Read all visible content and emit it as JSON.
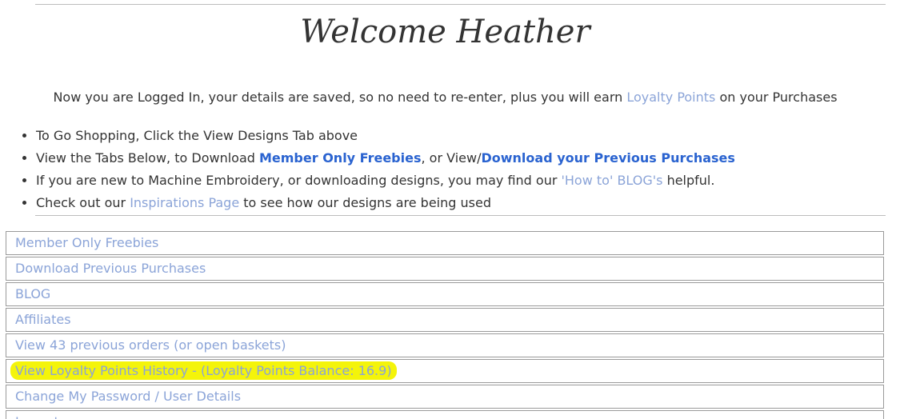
{
  "header": {
    "welcome": "Welcome Heather"
  },
  "intro": {
    "before": "Now you are Logged In, your details are saved, so no need to re-enter, plus you will earn ",
    "link": "Loyalty Points",
    "after": " on your Purchases"
  },
  "bullets": [
    {
      "before": "To Go Shopping, Click the View Designs Tab above"
    },
    {
      "before": "View the Tabs Below, to Download ",
      "link1": "Member Only Freebies",
      "middle": ", or View/",
      "link2": "Download your Previous Purchases"
    },
    {
      "before": "If you are new to Machine Embroidery, or downloading designs, you may find our ",
      "link": "'How to' BLOG's",
      "after": " helpful."
    },
    {
      "before": "Check out our ",
      "link": "Inspirations Page",
      "after": " to see how our designs are being used"
    }
  ],
  "menu": [
    "Member Only Freebies",
    "Download Previous Purchases",
    "BLOG",
    "Affiliates",
    "View 43 previous orders (or open baskets)",
    "View Loyalty Points History - (Loyalty Points Balance: 16.9)",
    "Change My Password / User Details",
    "Logout"
  ],
  "colors": {
    "highlight": "#f4f40a",
    "link_light": "#8ba4d8",
    "link_strong": "#2a63d0"
  }
}
